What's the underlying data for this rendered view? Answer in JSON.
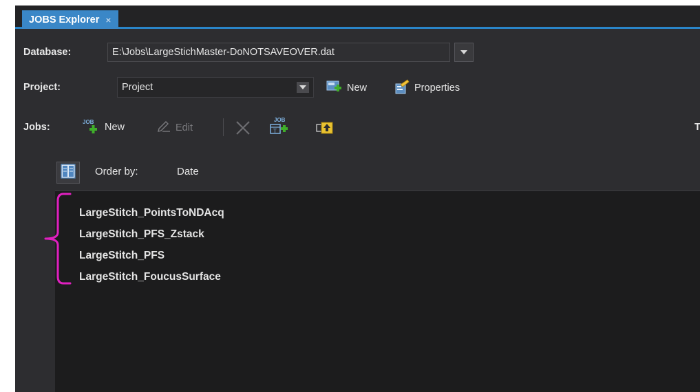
{
  "tab": {
    "title": "JOBS Explorer",
    "close_glyph": "×"
  },
  "database": {
    "label": "Database:",
    "path": "E:\\Jobs\\LargeStichMaster-DoNOTSAVEOVER.dat"
  },
  "project": {
    "label": "Project:",
    "selected": "Project",
    "new_label": "New",
    "properties_label": "Properties"
  },
  "jobs": {
    "label": "Jobs:",
    "new_label": "New",
    "edit_label": "Edit",
    "new_icon_text": "JOB",
    "template_icon_text": "JOB",
    "truncated_text": "T"
  },
  "list": {
    "order_label": "Order by:",
    "order_value": "Date",
    "items": [
      "LargeStitch_PointsToNDAcq",
      "LargeStitch_PFS_Zstack",
      "LargeStitch_PFS",
      "LargeStitch_FoucusSurface"
    ]
  },
  "colors": {
    "panel_bg": "#2d2d30",
    "list_bg": "#1c1c1d",
    "tab_accent": "#3a87c7",
    "annotation": "#e020c0"
  },
  "icons": {
    "database_dropdown": "chevron-down-icon",
    "project_dropdown": "chevron-down-icon",
    "project_new": "new-project-icon",
    "project_properties": "properties-icon",
    "job_new": "new-job-icon",
    "job_edit": "edit-icon",
    "job_delete": "delete-icon",
    "job_template": "job-template-icon",
    "job_export": "export-icon",
    "order_toggle": "list-view-icon"
  }
}
